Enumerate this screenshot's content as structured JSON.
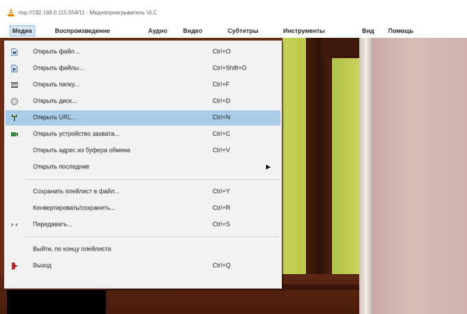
{
  "window": {
    "title": "rtsp://192.168.0.115:554/11 - Медиапроигрыватель VLC"
  },
  "menubar": {
    "items": [
      "Медиа",
      "Воспроизведение",
      "Аудио",
      "Видео",
      "Субтитры",
      "Инструменты",
      "Вид",
      "Помощь"
    ]
  },
  "media_menu": {
    "items": [
      {
        "label": "Открыть файл...",
        "shortcut": "Ctrl+O",
        "icon": "file-icon"
      },
      {
        "label": "Открыть файлы...",
        "shortcut": "Ctrl+Shift+O",
        "icon": "files-icon"
      },
      {
        "label": "Открыть папку...",
        "shortcut": "Ctrl+F",
        "icon": "folder-icon"
      },
      {
        "label": "Открыть диск...",
        "shortcut": "Ctrl+D",
        "icon": "disc-icon"
      },
      {
        "label": "Открыть URL...",
        "shortcut": "Ctrl+N",
        "icon": "network-icon"
      },
      {
        "label": "Открыть устройство захвата...",
        "shortcut": "Ctrl+C",
        "icon": "capture-icon"
      },
      {
        "label": "Открыть адрес из буфера обмена",
        "shortcut": "Ctrl+V",
        "icon": ""
      },
      {
        "label": "Открыть последние",
        "shortcut": "",
        "icon": ""
      },
      {
        "label": "Сохранить плейлист в файл...",
        "shortcut": "Ctrl+Y",
        "icon": ""
      },
      {
        "label": "Конвертировать/сохранить...",
        "shortcut": "Ctrl+R",
        "icon": ""
      },
      {
        "label": "Передавать...",
        "shortcut": "Ctrl+S",
        "icon": "stream-icon"
      },
      {
        "label": "Выйти, по концу плейлиста",
        "shortcut": "",
        "icon": ""
      },
      {
        "label": "Выход",
        "shortcut": "Ctrl+Q",
        "icon": "quit-icon"
      }
    ],
    "highlighted_index": 4
  },
  "colors": {
    "highlight": "#a9cde8",
    "menu_bg": "#f2f2f2",
    "accent": "#f08a00"
  }
}
